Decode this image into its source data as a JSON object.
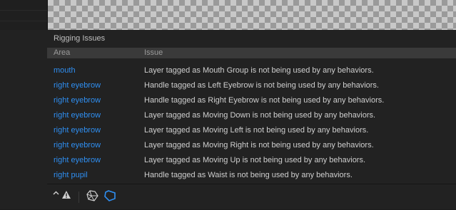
{
  "panel": {
    "title": "Rigging Issues",
    "columns": {
      "area": "Area",
      "issue": "Issue"
    },
    "rows": [
      {
        "area": "mouth",
        "issue": "Layer tagged as Mouth Group is not being used by any behaviors."
      },
      {
        "area": "right eyebrow",
        "issue": "Handle tagged as Left Eyebrow is not being used by any behaviors."
      },
      {
        "area": "right eyebrow",
        "issue": "Handle tagged as Right Eyebrow is not being used by any behaviors."
      },
      {
        "area": "right eyebrow",
        "issue": "Layer tagged as Moving Down is not being used by any behaviors."
      },
      {
        "area": "right eyebrow",
        "issue": "Layer tagged as Moving Left is not being used by any behaviors."
      },
      {
        "area": "right eyebrow",
        "issue": "Layer tagged as Moving Right is not being used by any behaviors."
      },
      {
        "area": "right eyebrow",
        "issue": "Layer tagged as Moving Up is not being used by any behaviors."
      },
      {
        "area": "right pupil",
        "issue": "Handle tagged as Waist is not being used by any behaviors."
      }
    ]
  },
  "footer": {
    "icons": [
      "chevron-up-icon",
      "warning-icon",
      "mesh-icon",
      "polygon-icon"
    ]
  },
  "colors": {
    "accent": "#2f8ff2",
    "panel_bg": "#222222",
    "header_bg": "#3a3a3a",
    "text": "#cfcfcf"
  }
}
